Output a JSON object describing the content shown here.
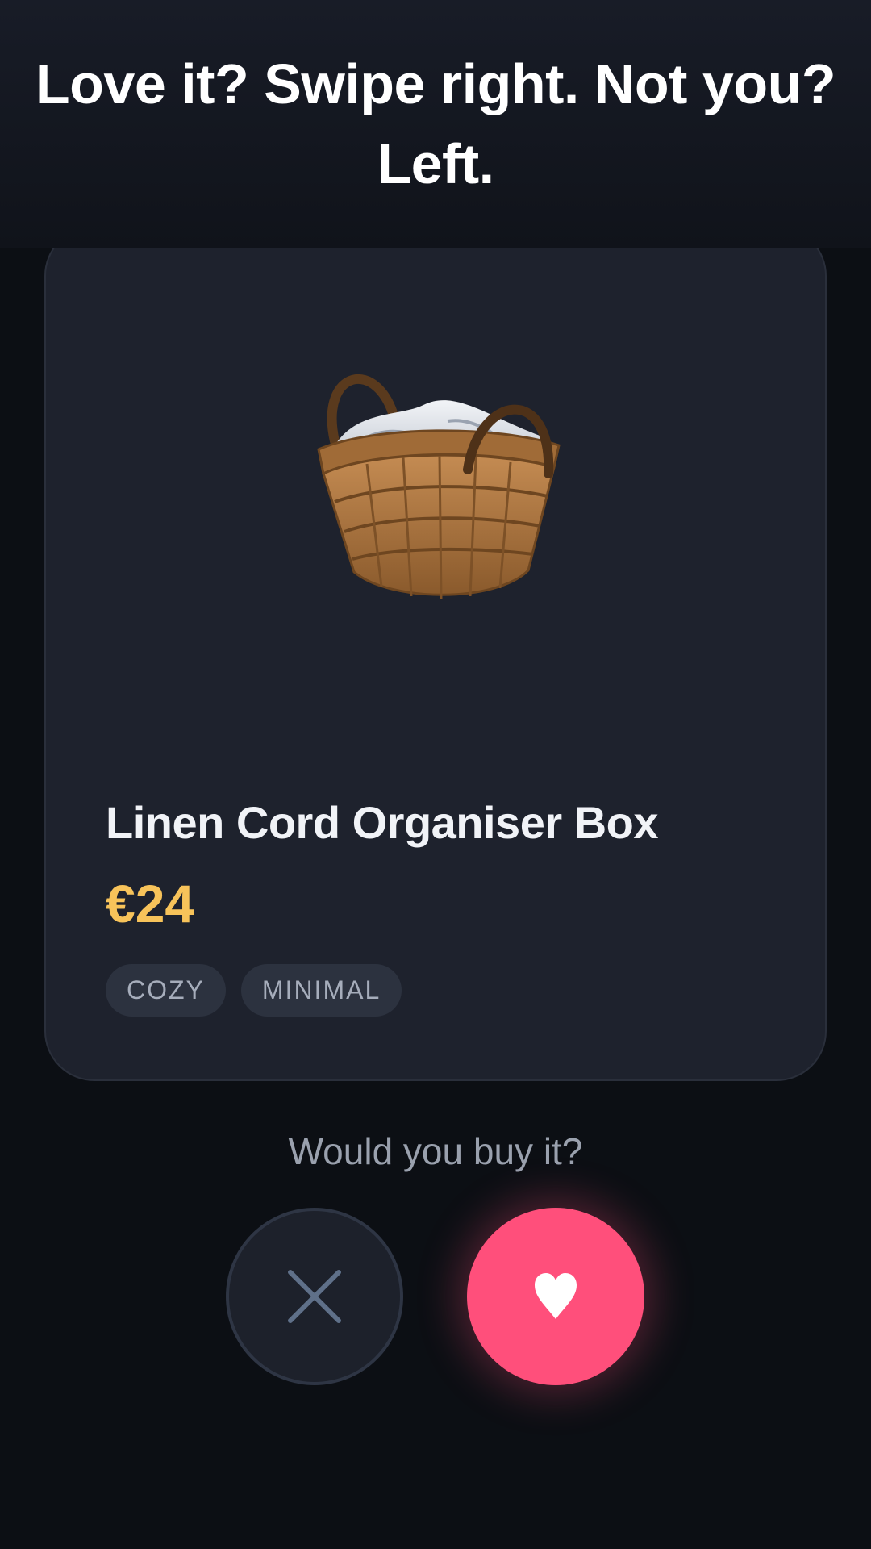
{
  "header": {
    "title": "Love it? Swipe right. Not you? Left."
  },
  "card": {
    "image_icon": "basket-icon",
    "title": "Linen Cord Organiser Box",
    "price": "€24",
    "tags": [
      "COZY",
      "MINIMAL"
    ]
  },
  "prompt": "Would you buy it?",
  "actions": {
    "nope_icon": "close-icon",
    "like_icon": "heart-icon"
  },
  "colors": {
    "background": "#0c0f14",
    "card": "#1e222d",
    "price": "#f7c35a",
    "like": "#ff4f7b",
    "nope_icon": "#5f7089"
  }
}
